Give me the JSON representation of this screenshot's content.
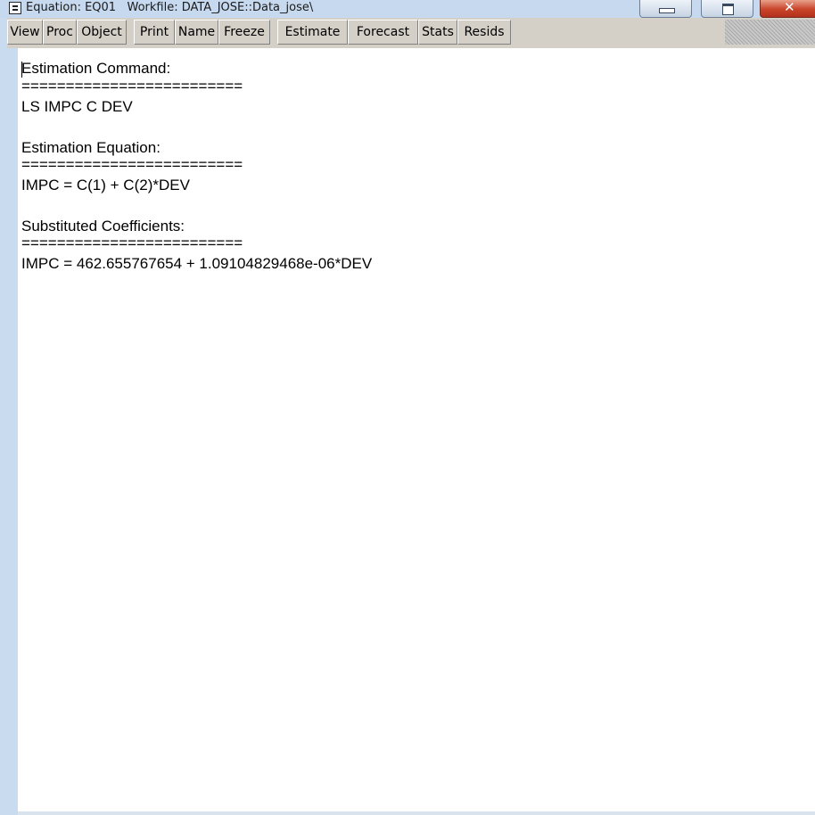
{
  "window": {
    "title": "Equation: EQ01   Workfile: DATA_JOSE::Data_jose\\",
    "icons": {
      "system_menu": "eviews-equation-icon",
      "minimize": "minimize-icon",
      "maximize": "maximize-icon",
      "close": "close-icon"
    },
    "close_glyph": "✕",
    "colors": {
      "title_bar": "#c7d9ee",
      "close_button": "#c8442a",
      "toolbar": "#d4d0c8",
      "content": "#ffffff"
    }
  },
  "toolbar": {
    "buttons": [
      "View",
      "Proc",
      "Object",
      "Print",
      "Name",
      "Freeze",
      "Estimate",
      "Forecast",
      "Stats",
      "Resids"
    ]
  },
  "content": {
    "lines": [
      "Estimation Command:",
      "=========================",
      "LS IMPC C DEV",
      "",
      "Estimation Equation:",
      "=========================",
      "IMPC = C(1) + C(2)*DEV",
      "",
      "Substituted Coefficients:",
      "=========================",
      "IMPC = 462.655767654 + 1.09104829468e-06*DEV"
    ]
  }
}
